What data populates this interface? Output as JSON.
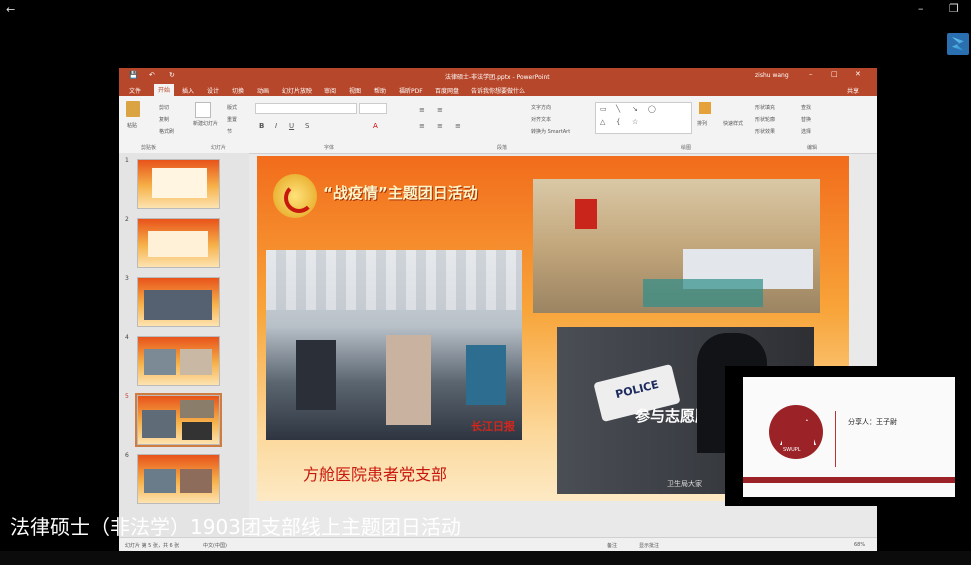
{
  "window": {
    "back_icon": "arrow-left-icon",
    "minimize_icon": "minimize-icon",
    "restore_icon": "restore-icon",
    "app_badge_icon": "app-badge-icon"
  },
  "ppt": {
    "title": "法律硕士-非法学团.pptx - PowerPoint",
    "user": "zishu wang",
    "tabs": [
      "文件",
      "开始",
      "插入",
      "设计",
      "切换",
      "动画",
      "幻灯片放映",
      "审阅",
      "视图",
      "帮助",
      "福昕PDF",
      "百度网盘",
      "告诉我你想要做什么"
    ],
    "share": "共享",
    "ribbon": {
      "paste": "粘贴",
      "cut": "剪切",
      "copy": "复制",
      "format_painter": "格式刷",
      "clipboard": "剪贴板",
      "new_slide": "新建幻灯片",
      "layout": "版式",
      "reset": "重置",
      "section": "节",
      "slides_group": "幻灯片",
      "font_group": "字体",
      "paragraph_group": "段落",
      "text_direction": "文字方向",
      "align_text": "对齐文本",
      "smartart": "转换为 SmartArt",
      "drawing_group": "绘图",
      "arrange": "排列",
      "quick_styles": "快速样式",
      "shape_fill": "形状填充",
      "shape_outline": "形状轮廓",
      "shape_effects": "形状效果",
      "find": "查找",
      "replace": "替换",
      "select": "选择",
      "editing_group": "编辑"
    },
    "slide_numbers": [
      "1",
      "2",
      "3",
      "4",
      "5",
      "6"
    ],
    "status": {
      "slide_info": "幻灯片 第 5 张，共 6 张",
      "lang": "中文(中国)",
      "notes": "备注",
      "comments": "显示批注",
      "zoom": "68%"
    }
  },
  "slide": {
    "title": "“战疫情”主题团日活动",
    "caption": "方舱医院患者党支部",
    "police_text": "POLICE",
    "volunteer_text": "参与志愿服务",
    "photo_credit": "卫生局大家",
    "watermark": "长江日报"
  },
  "presenter": {
    "label": "分享人：王子尉",
    "logo_text": "SWUPL"
  },
  "subtitle": "法律硕士（非法学）1903团支部线上主题团日活动",
  "colors": {
    "ppt_red": "#b7472a",
    "slide_orange": "#f26c1b",
    "caption_red": "#c8170d"
  }
}
